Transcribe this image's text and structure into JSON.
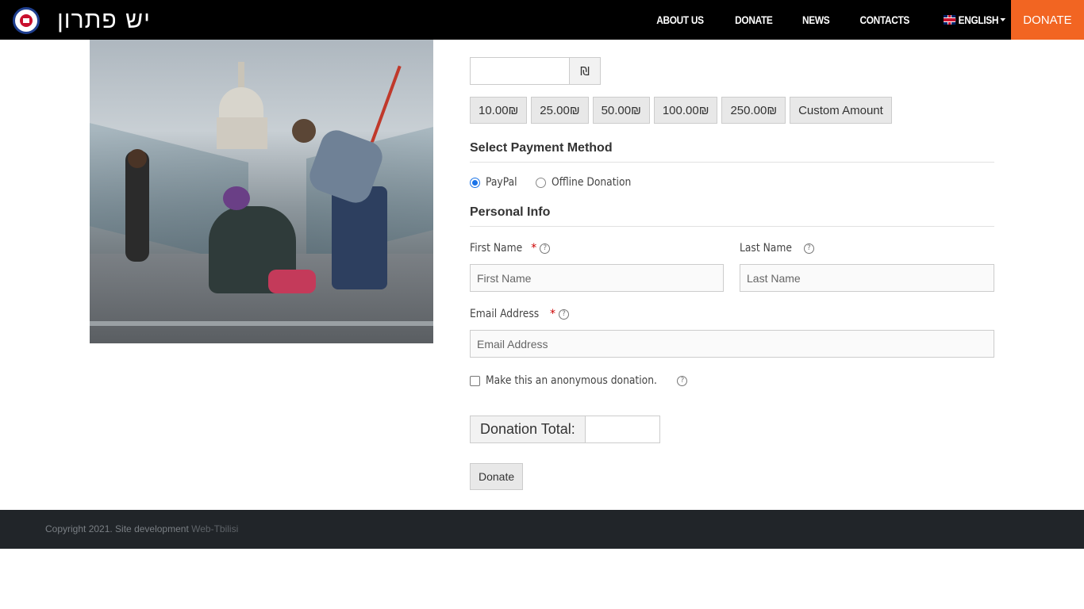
{
  "header": {
    "logo_text": "יש פתרון",
    "nav": [
      "ABOUT US",
      "DONATE",
      "NEWS",
      "CONTACTS"
    ],
    "language": "ENGLISH",
    "donate_button": "DONATE"
  },
  "photo": {
    "description_icon": "photo-image"
  },
  "form": {
    "amount": {
      "value": "",
      "currency_symbol": "₪"
    },
    "levels": [
      "10.00₪",
      "25.00₪",
      "50.00₪",
      "100.00₪",
      "250.00₪",
      "Custom Amount"
    ],
    "payment": {
      "title": "Select Payment Method",
      "options": [
        {
          "label": "PayPal",
          "checked": true
        },
        {
          "label": "Offline Donation",
          "checked": false
        }
      ]
    },
    "personal": {
      "title": "Personal Info",
      "first_name_label": "First Name",
      "first_name_placeholder": "First Name",
      "last_name_label": "Last Name",
      "last_name_placeholder": "Last Name",
      "email_label": "Email Address",
      "email_placeholder": "Email Address",
      "required_mark": "*",
      "help_icon": "?"
    },
    "anonymous": {
      "label": "Make this an anonymous donation.",
      "checked": false
    },
    "total": {
      "label": "Donation Total:",
      "value": ""
    },
    "submit_label": "Donate"
  },
  "footer": {
    "copyright": "Copyright 2021. Site development",
    "developer": "Web-Tbilisi"
  },
  "colors": {
    "header_bg": "#000000",
    "donate_accent": "#f26522",
    "footer_bg": "#212529",
    "radio_checked": "#1a73e8"
  }
}
